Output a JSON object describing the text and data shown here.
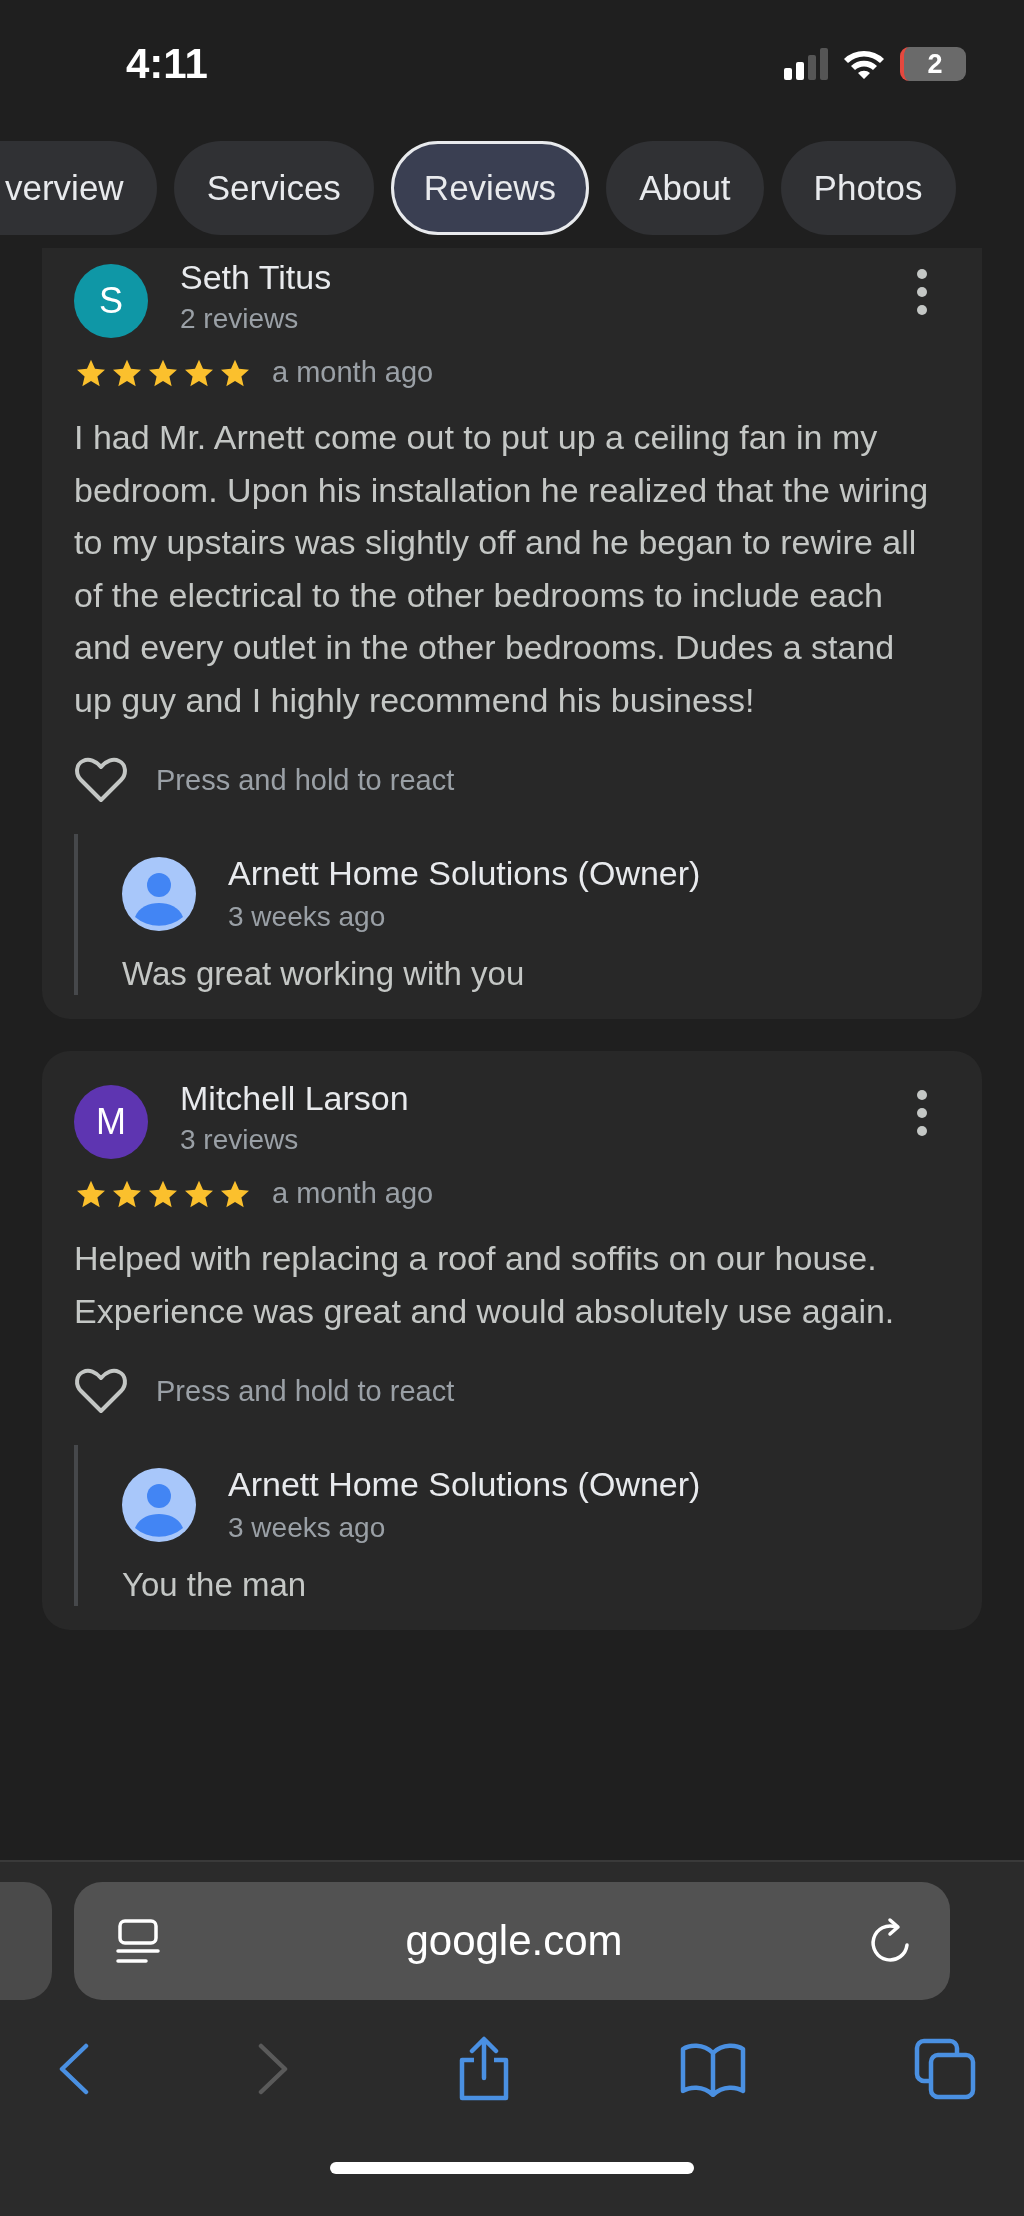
{
  "status_bar": {
    "time": "4:11",
    "battery": "2"
  },
  "tabs": [
    {
      "label": "verview",
      "selected": false
    },
    {
      "label": "Services",
      "selected": false
    },
    {
      "label": "Reviews",
      "selected": true
    },
    {
      "label": "About",
      "selected": false
    },
    {
      "label": "Photos",
      "selected": false
    }
  ],
  "reviews": [
    {
      "initial": "S",
      "color": "#0f97a6",
      "name": "Seth Titus",
      "count": "2 reviews",
      "stars": 5,
      "time": "a month ago",
      "text": "I had Mr. Arnett come out to put up a ceiling fan in my bedroom. Upon his installation he realized that the wiring to my upstairs was slightly off and he began to rewire all of the electrical to the other bedrooms to include each and every outlet in the other bedrooms. Dudes a stand up guy and I highly recommend his business!",
      "react": "Press and hold to react",
      "reply": {
        "name": "Arnett Home Solutions (Owner)",
        "time": "3 weeks ago",
        "text": "Was great working with you"
      }
    },
    {
      "initial": "M",
      "color": "#5e35b1",
      "name": "Mitchell Larson",
      "count": "3 reviews",
      "stars": 5,
      "time": "a month ago",
      "text": "Helped with replacing a roof and soffits on our house. Experience was great and would absolutely use again.",
      "react": "Press and hold to react",
      "reply": {
        "name": "Arnett Home Solutions (Owner)",
        "time": "3 weeks ago",
        "text": "You the man"
      }
    }
  ],
  "address_bar": {
    "url": "google.com"
  }
}
